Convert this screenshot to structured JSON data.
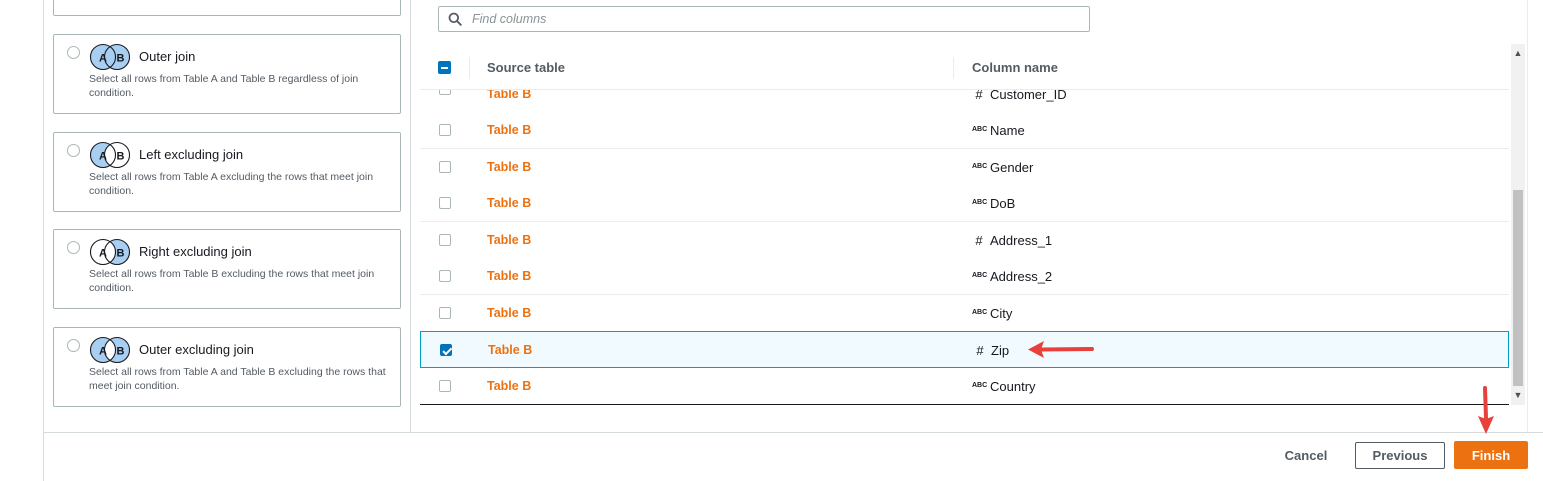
{
  "join_types": [
    {
      "title": "Outer join",
      "description": "Select all rows from Table A and Table B regardless of join condition.",
      "left_filled": true,
      "center_filled": true,
      "right_filled": true
    },
    {
      "title": "Left excluding join",
      "description": "Select all rows from Table A excluding the rows that meet join condition.",
      "left_filled": true,
      "center_filled": false,
      "right_filled": false
    },
    {
      "title": "Right excluding join",
      "description": "Select all rows from Table B excluding the rows that meet join condition.",
      "left_filled": false,
      "center_filled": false,
      "right_filled": true
    },
    {
      "title": "Outer excluding join",
      "description": "Select all rows from Table A and Table B excluding the rows that meet join condition.",
      "left_filled": true,
      "center_filled": false,
      "right_filled": true
    }
  ],
  "venn_labels": {
    "a": "A",
    "b": "B"
  },
  "search": {
    "placeholder": "Find columns"
  },
  "table": {
    "headers": {
      "source": "Source table",
      "column": "Column name"
    },
    "rows": [
      {
        "source": "Table B",
        "type_icon": "hash",
        "column": "Customer_ID",
        "checked": false
      },
      {
        "source": "Table B",
        "type_icon": "abc",
        "column": "Name",
        "checked": false
      },
      {
        "source": "Table B",
        "type_icon": "abc",
        "column": "Gender",
        "checked": false
      },
      {
        "source": "Table B",
        "type_icon": "abc",
        "column": "DoB",
        "checked": false
      },
      {
        "source": "Table B",
        "type_icon": "hash",
        "column": "Address_1",
        "checked": false
      },
      {
        "source": "Table B",
        "type_icon": "abc",
        "column": "Address_2",
        "checked": false
      },
      {
        "source": "Table B",
        "type_icon": "abc",
        "column": "City",
        "checked": false
      },
      {
        "source": "Table B",
        "type_icon": "hash",
        "column": "Zip",
        "checked": true
      },
      {
        "source": "Table B",
        "type_icon": "abc",
        "column": "Country",
        "checked": false
      }
    ]
  },
  "type_glyphs": {
    "hash": "#",
    "abc": "ABC"
  },
  "footer": {
    "cancel": "Cancel",
    "previous": "Previous",
    "finish": "Finish"
  },
  "colors": {
    "accent": "#ec7211",
    "checkbox": "#0073bb",
    "annotation": "#e8413c",
    "venn_fill": "#a8cff2"
  }
}
